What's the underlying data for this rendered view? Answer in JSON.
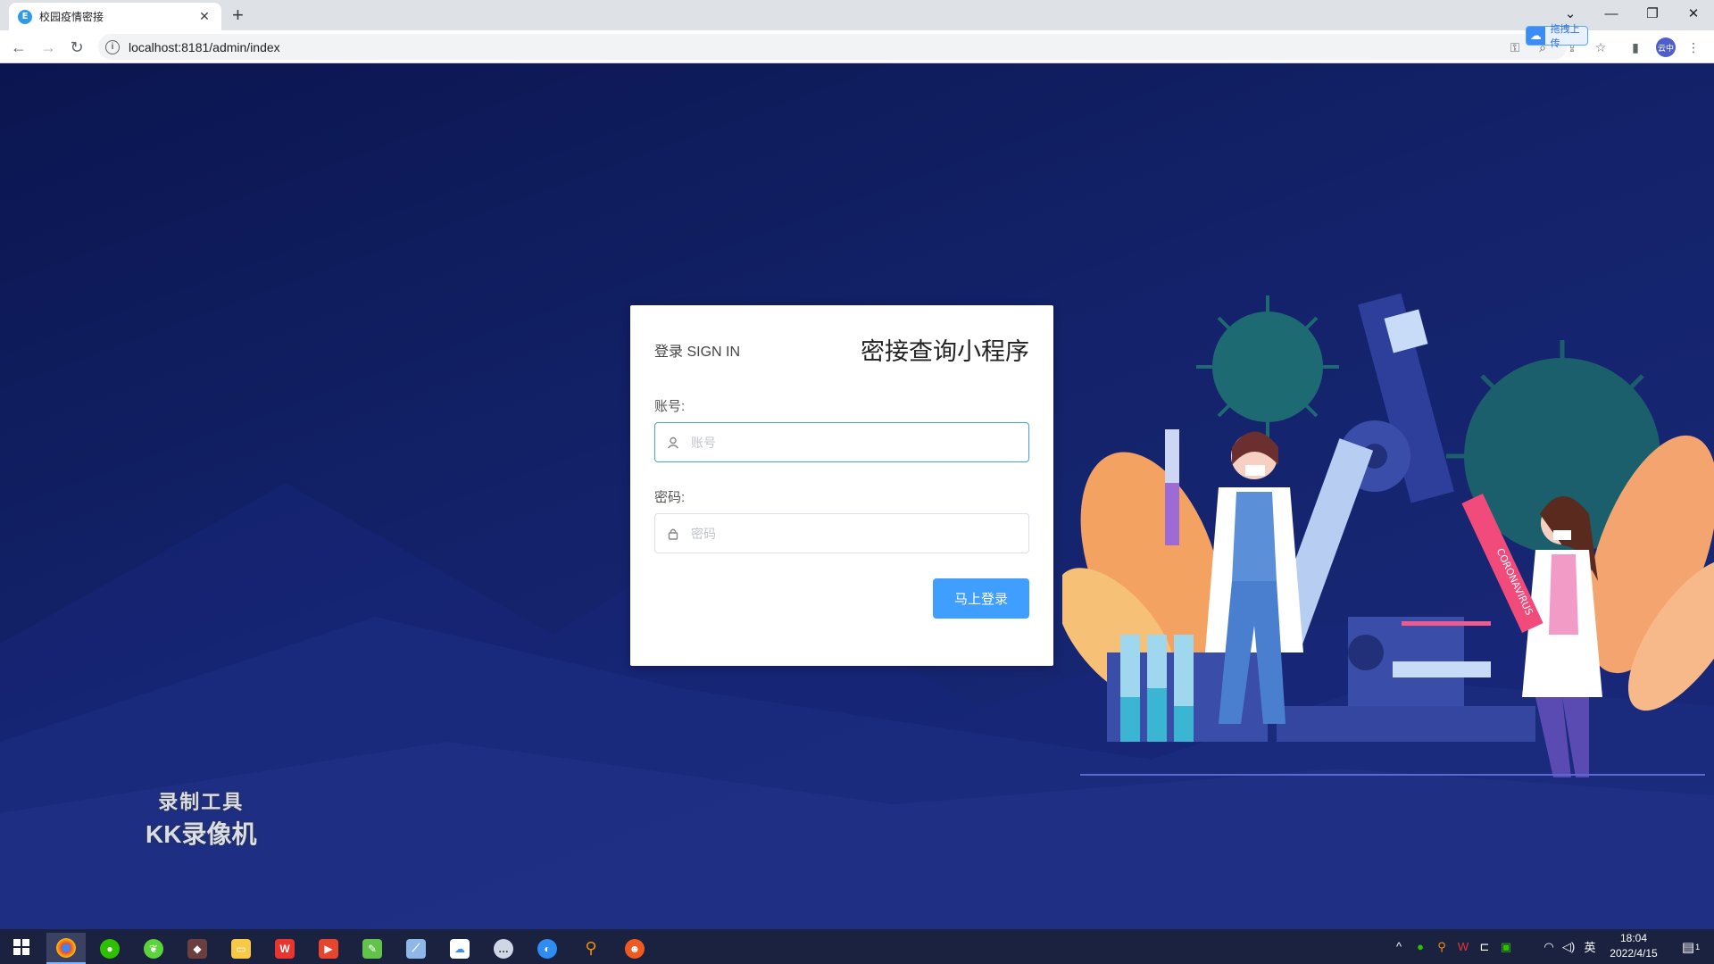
{
  "browser": {
    "tab_title": "校园疫情密接",
    "tab_favicon": "E",
    "new_tab_icon": "+",
    "close_icon": "✕",
    "url": "localhost:8181/admin/index",
    "upload_badge": "拖拽上传",
    "profile_label": "云中"
  },
  "login": {
    "sign_in_label": "登录 SIGN IN",
    "app_title": "密接查询小程序",
    "account_label": "账号:",
    "account_placeholder": "账号",
    "account_value": "",
    "password_label": "密码:",
    "password_placeholder": "密码",
    "password_value": "",
    "submit_label": "马上登录"
  },
  "illustration": {
    "test_tube_label": "CORONAVIRUS"
  },
  "watermark": {
    "line1": "录制工具",
    "line2": "KK录像机"
  },
  "taskbar": {
    "ime_label": "英",
    "time": "18:04",
    "date": "2022/4/15",
    "notification_count": "1"
  },
  "colors": {
    "primary_button": "#409eff",
    "page_bg": "#13226a",
    "taskbar_bg": "#1b2240"
  }
}
